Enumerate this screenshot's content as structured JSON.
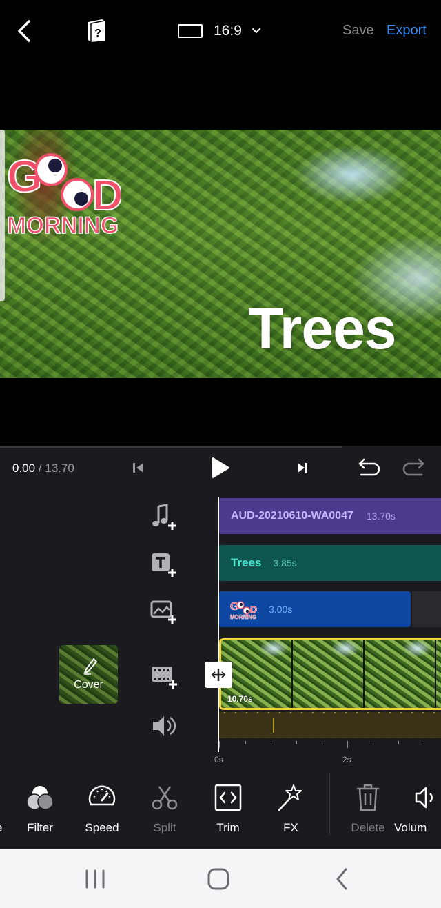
{
  "topbar": {
    "aspect_ratio": "16:9",
    "save_label": "Save",
    "export_label": "Export",
    "accent_color": "#3a8ef6"
  },
  "preview": {
    "sticker_text": "GOOD MORNING",
    "title_text": "Trees"
  },
  "player": {
    "current_time": "0.00",
    "total_time": " / 13.70"
  },
  "tracks": {
    "audio": {
      "name": "AUD-20210610-WA0047",
      "duration": "13.70s"
    },
    "text": {
      "name": "Trees",
      "duration": "3.85s"
    },
    "sticker": {
      "duration": "3.00s"
    },
    "video": {
      "duration": "10.70s"
    }
  },
  "cover": {
    "label": "Cover"
  },
  "ruler": {
    "labels": [
      "0s",
      "2s"
    ]
  },
  "toolbar": {
    "items": [
      {
        "label": "Filter",
        "icon": "filter-icon",
        "enabled": true
      },
      {
        "label": "Speed",
        "icon": "speedometer-icon",
        "enabled": true
      },
      {
        "label": "Split",
        "icon": "scissors-icon",
        "enabled": false
      },
      {
        "label": "Trim",
        "icon": "trim-icon",
        "enabled": true
      },
      {
        "label": "FX",
        "icon": "magic-wand-icon",
        "enabled": true
      },
      {
        "label": "Delete",
        "icon": "trash-icon",
        "enabled": false
      },
      {
        "label": "Volum",
        "icon": "volume-icon",
        "enabled": true
      }
    ],
    "edge_label": "e"
  },
  "colors": {
    "audio_track": "#4b3a8e",
    "text_track": "#0f5651",
    "sticker_track": "#0d47a1",
    "video_selected_border": "#f5d33a"
  }
}
